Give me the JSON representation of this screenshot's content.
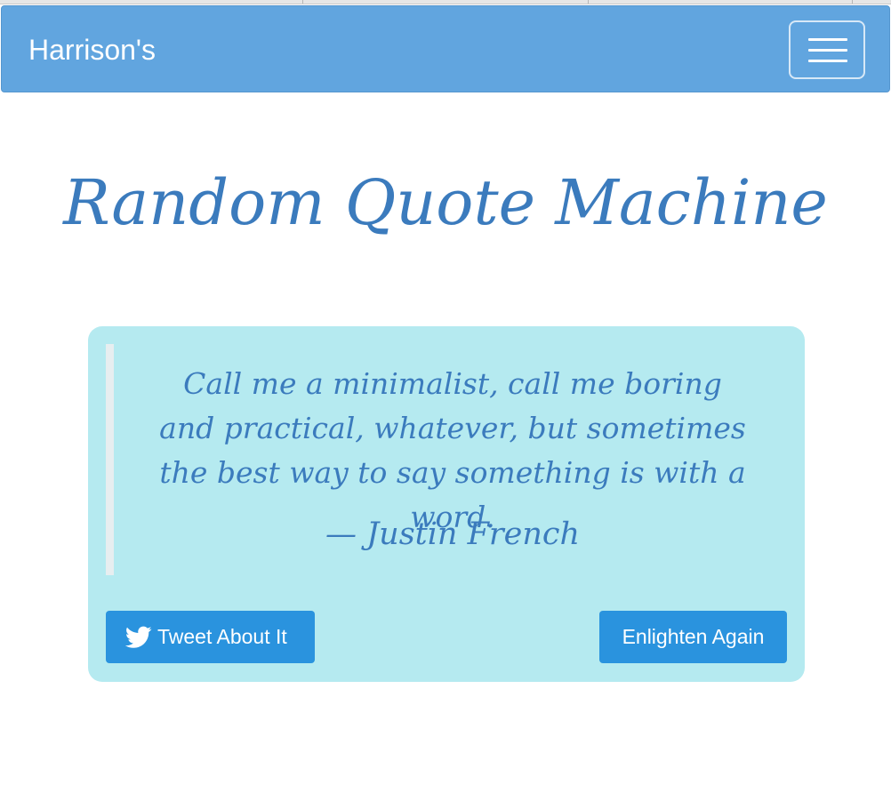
{
  "navbar": {
    "brand": "Harrison's",
    "menu_toggle_icon": "hamburger-menu-icon",
    "color": "#61a5df"
  },
  "page": {
    "title": "Random Quote Machine",
    "accent_color": "#3b7bbd"
  },
  "quote": {
    "text": "Call me a minimalist, call me boring and practical, whatever, but sometimes the best way to say something is with a word.",
    "author": "— Justin French",
    "card_color": "#b5eaf0"
  },
  "actions": {
    "tweet_label": "Tweet About It",
    "tweet_icon": "twitter-bird-icon",
    "new_quote_label": "Enlighten Again",
    "button_color": "#2a93de"
  }
}
